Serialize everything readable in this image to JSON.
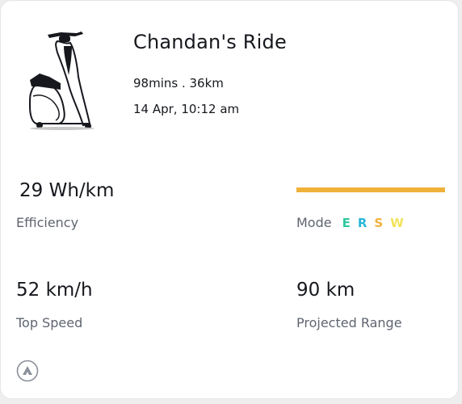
{
  "ride": {
    "title": "Chandan's Ride",
    "summary": "98mins . 36km",
    "datetime": "14 Apr, 10:12 am"
  },
  "stats": {
    "efficiency": {
      "value": "29 Wh/km",
      "label": "Efficiency"
    },
    "top_speed": {
      "value": "52 km/h",
      "label": "Top Speed"
    },
    "projected_range": {
      "value": "90 km",
      "label": "Projected Range"
    }
  },
  "mode": {
    "label": "Mode",
    "bar_color": "#f0b13a",
    "letters": [
      {
        "letter": "E",
        "color": "#2fc9a1"
      },
      {
        "letter": "R",
        "color": "#29b6d8"
      },
      {
        "letter": "S",
        "color": "#f0b13a"
      },
      {
        "letter": "W",
        "color": "#f2e35a"
      }
    ]
  },
  "icons": {
    "scooter": "scooter-illustration",
    "brand": "brand-logo-icon"
  }
}
